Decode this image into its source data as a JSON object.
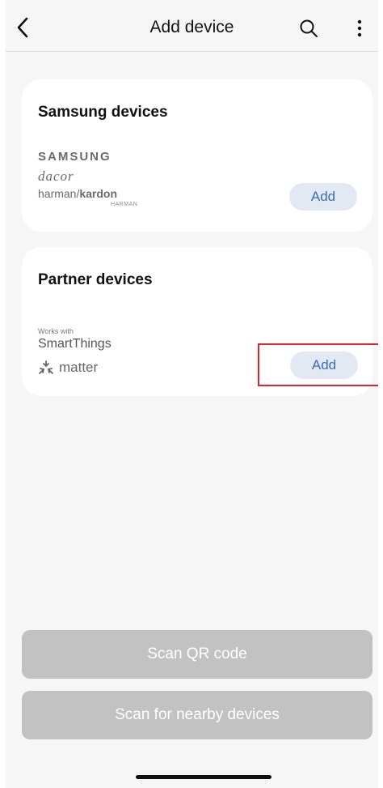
{
  "header": {
    "title": "Add device",
    "back_icon": "chevron-left-icon",
    "search_icon": "search-icon",
    "more_icon": "more-vertical-icon"
  },
  "samsung_card": {
    "title": "Samsung devices",
    "brands": {
      "samsung": "SAMSUNG",
      "dacor": "dacor",
      "harman_left": "harman/",
      "harman_right": "kardon",
      "harman_sub": "HARMAN"
    },
    "add_label": "Add"
  },
  "partner_card": {
    "title": "Partner devices",
    "works_with": "Works with",
    "smartthings": "SmartThings",
    "matter": "matter",
    "add_label": "Add"
  },
  "bottom": {
    "scan_qr_label": "Scan QR code",
    "scan_nearby_label": "Scan for nearby devices"
  },
  "colors": {
    "accent_text": "#3a6fb4",
    "add_button_bg": "#e3e9f3",
    "disabled_button_bg": "#c2c2c2",
    "highlight": "#e0242c"
  }
}
